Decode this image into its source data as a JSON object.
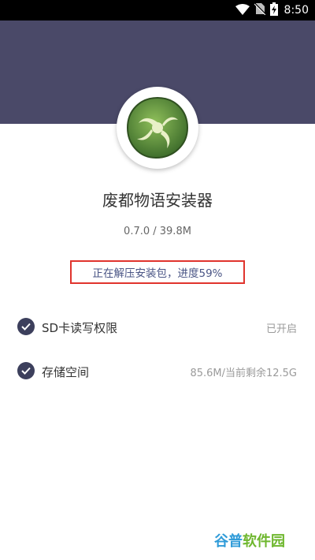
{
  "status_bar": {
    "time": "8:50",
    "icons": [
      "wifi-icon",
      "no-sim-icon",
      "battery-charging-icon"
    ]
  },
  "app": {
    "icon": "app-logo-icon",
    "title": "废都物语安装器",
    "version_size": "0.7.0 / 39.8M",
    "progress_text": "正在解压安装包，进度59%",
    "progress_percent": 59
  },
  "permissions": [
    {
      "label": "SD卡读写权限",
      "value": "已开启",
      "icon": "check-circle-icon"
    },
    {
      "label": "存储空间",
      "value": "85.6M/当前剩余12.5G",
      "icon": "check-circle-icon"
    }
  ],
  "watermark": {
    "part1": "谷普",
    "part2": "软件园"
  },
  "colors": {
    "header_band": "#4a4968",
    "progress_border": "#e0342d",
    "progress_text": "#4a5585",
    "check_circle": "#3c3f5c"
  }
}
